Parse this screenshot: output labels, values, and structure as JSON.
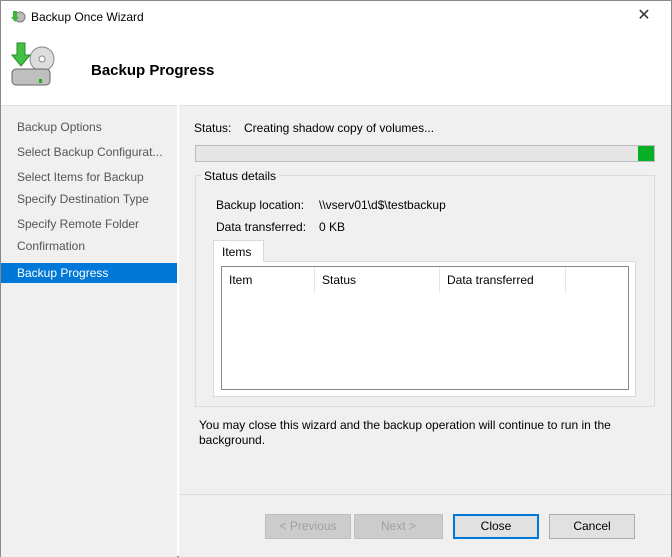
{
  "window": {
    "title": "Backup Once Wizard",
    "close": "✕"
  },
  "header": {
    "title": "Backup Progress"
  },
  "sidebar": {
    "items": [
      {
        "label": "Backup Options"
      },
      {
        "label": "Select Backup Configurat..."
      },
      {
        "label": "Select Items for Backup"
      },
      {
        "label": "Specify Destination Type"
      },
      {
        "label": "Specify Remote Folder"
      },
      {
        "label": "Confirmation"
      },
      {
        "label": "Backup Progress",
        "selected": true
      }
    ]
  },
  "status": {
    "label": "Status:",
    "value": "Creating shadow copy of volumes...",
    "progress_percent": 3
  },
  "details": {
    "group_label": "Status details",
    "location_label": "Backup location:",
    "location_value": "\\\\vserv01\\d$\\testbackup",
    "transferred_label": "Data transferred:",
    "transferred_value": "0 KB"
  },
  "items_tab": {
    "label": "Items",
    "columns": [
      "Item",
      "Status",
      "Data transferred"
    ]
  },
  "note": "You may close this wizard and the backup operation will continue to run in the background.",
  "buttons": {
    "previous": "< Previous",
    "next": "Next >",
    "close": "Close",
    "cancel": "Cancel"
  },
  "colors": {
    "accent": "#0078d7",
    "progress": "#06b025"
  }
}
